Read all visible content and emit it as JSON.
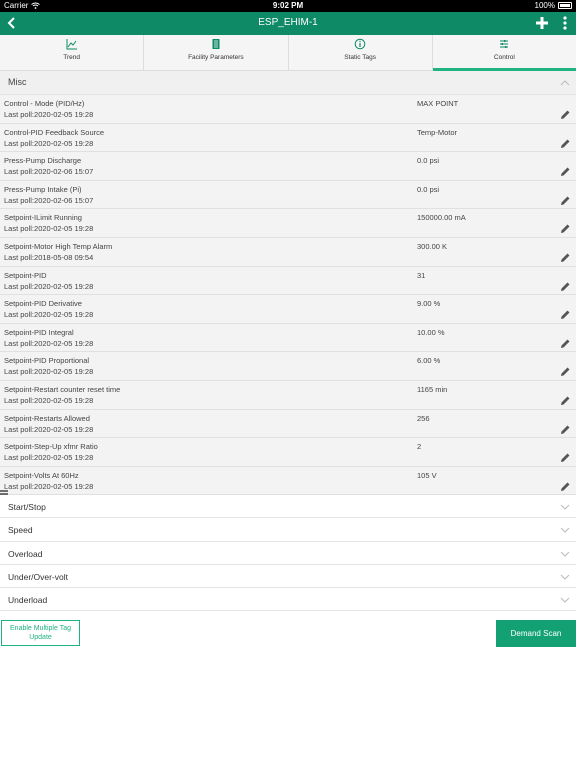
{
  "status_bar": {
    "carrier": "Carrier",
    "time": "9:02 PM",
    "battery": "100%"
  },
  "app_bar": {
    "title": "ESP_EHIM-1"
  },
  "tabs": [
    {
      "label": "Trend",
      "icon": "chart-icon"
    },
    {
      "label": "Facility Parameters",
      "icon": "list-icon"
    },
    {
      "label": "Static Tags",
      "icon": "info-icon"
    },
    {
      "label": "Control",
      "icon": "sliders-icon",
      "active": true
    }
  ],
  "misc": {
    "title": "Misc",
    "rows": [
      {
        "name": "Control - Mode (PID/Hz)",
        "poll": "Last poll:2020-02-05 19:28",
        "value": "MAX POINT"
      },
      {
        "name": "Control-PID Feedback Source",
        "poll": "Last poll:2020-02-05 19:28",
        "value": "Temp-Motor"
      },
      {
        "name": "Press-Pump Discharge",
        "poll": "Last poll:2020-02-06 15:07",
        "value": "0.0 psi"
      },
      {
        "name": "Press-Pump Intake (Pi)",
        "poll": "Last poll:2020-02-06 15:07",
        "value": "0.0 psi"
      },
      {
        "name": "Setpoint-ILimit Running",
        "poll": "Last poll:2020-02-05 19:28",
        "value": "150000.00 mA"
      },
      {
        "name": "Setpoint-Motor High Temp Alarm",
        "poll": "Last poll:2018-05-08 09:54",
        "value": "300.00 K"
      },
      {
        "name": "Setpoint-PID",
        "poll": "Last poll:2020-02-05 19:28",
        "value": "31"
      },
      {
        "name": "Setpoint-PID Derivative",
        "poll": "Last poll:2020-02-05 19:28",
        "value": "9.00 %"
      },
      {
        "name": "Setpoint-PID Integral",
        "poll": "Last poll:2020-02-05 19:28",
        "value": "10.00 %"
      },
      {
        "name": "Setpoint-PID Proportional",
        "poll": "Last poll:2020-02-05 19:28",
        "value": "6.00 %"
      },
      {
        "name": "Setpoint-Restart counter reset time",
        "poll": "Last poll:2020-02-05 19:28",
        "value": "1165 min"
      },
      {
        "name": "Setpoint-Restarts Allowed",
        "poll": "Last poll:2020-02-05 19:28",
        "value": "256"
      },
      {
        "name": "Setpoint-Step-Up xfmr Ratio",
        "poll": "Last poll:2020-02-05 19:28",
        "value": "2"
      },
      {
        "name": "Setpoint-Volts At 60Hz",
        "poll": "Last poll:2020-02-05 19:28",
        "value": "105 V"
      }
    ]
  },
  "groups": [
    "Start/Stop",
    "Speed",
    "Overload",
    "Under/Over-volt",
    "Underload"
  ],
  "buttons": {
    "multi_update": "Enable Multiple Tag Update",
    "demand_scan": "Demand Scan"
  },
  "colors": {
    "primary": "#0e8a66",
    "accent": "#1fb37f",
    "button": "#13a173"
  }
}
